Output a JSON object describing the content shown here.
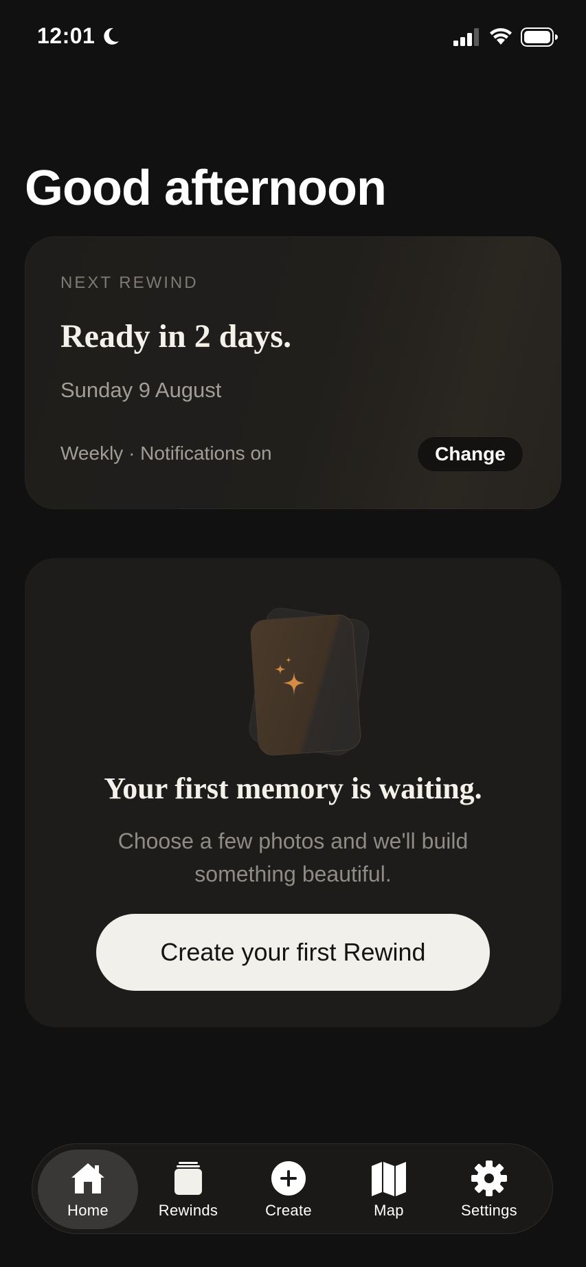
{
  "status_bar": {
    "time": "12:01"
  },
  "greeting": "Good afternoon",
  "next_rewind": {
    "eyebrow": "NEXT REWIND",
    "title": "Ready in 2 days.",
    "date": "Sunday 9 August",
    "meta": "Weekly · Notifications on",
    "change_label": "Change"
  },
  "empty_state": {
    "title": "Your first memory is waiting.",
    "subtitle": "Choose a few photos and we'll build something beautiful.",
    "button_label": "Create your first Rewind"
  },
  "tabs": [
    {
      "label": "Home",
      "icon": "home-icon",
      "active": true
    },
    {
      "label": "Rewinds",
      "icon": "stack-icon",
      "active": false
    },
    {
      "label": "Create",
      "icon": "plus-circle-icon",
      "active": false
    },
    {
      "label": "Map",
      "icon": "map-icon",
      "active": false
    },
    {
      "label": "Settings",
      "icon": "gear-icon",
      "active": false
    }
  ],
  "colors": {
    "background": "#111111",
    "accent": "#d38b45",
    "button_light": "#f2f0eb"
  }
}
